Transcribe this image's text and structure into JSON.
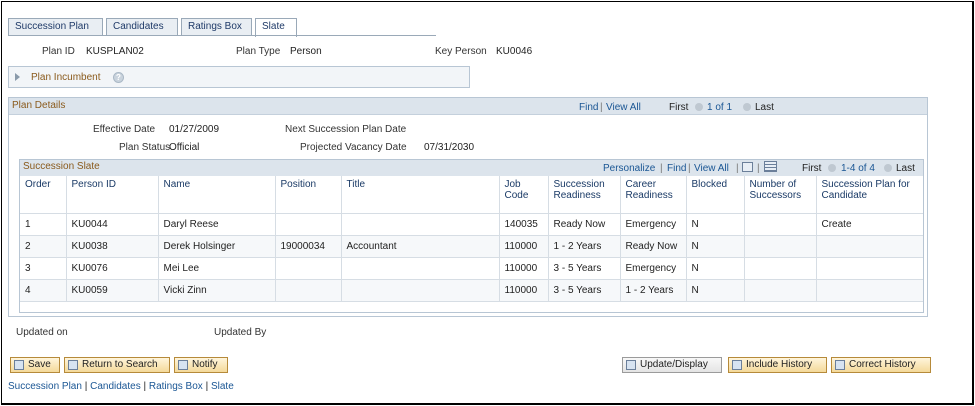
{
  "tabs": [
    {
      "label": "Succession Plan",
      "active": false
    },
    {
      "label": "Candidates",
      "active": false
    },
    {
      "label": "Ratings Box",
      "active": false
    },
    {
      "label": "Slate",
      "active": true
    }
  ],
  "header": {
    "plan_id_label": "Plan ID",
    "plan_id": "KUSPLAN02",
    "plan_type_label": "Plan Type",
    "plan_type": "Person",
    "key_person_label": "Key Person",
    "key_person": "KU0046"
  },
  "incumbent": {
    "label": "Plan Incumbent",
    "help_glyph": "?"
  },
  "details": {
    "title": "Plan Details",
    "find_label": "Find",
    "view_all_label": "View All",
    "first_label": "First",
    "count": "1 of 1",
    "last_label": "Last",
    "effective_date_label": "Effective Date",
    "effective_date": "01/27/2009",
    "next_plan_date_label": "Next Succession Plan Date",
    "plan_status_label": "Plan Status",
    "plan_status": "Official",
    "projected_vacancy_label": "Projected Vacancy Date",
    "projected_vacancy": "07/31/2030"
  },
  "slate": {
    "title": "Succession Slate",
    "personalize_label": "Personalize",
    "find_label": "Find",
    "view_all_label": "View All",
    "first_label": "First",
    "count": "1-4 of 4",
    "last_label": "Last",
    "columns": [
      "Order",
      "Person ID",
      "Name",
      "Position",
      "Title",
      "Job Code",
      "Succession Readiness",
      "Career Readiness",
      "Blocked",
      "Number of Successors",
      "Succession Plan for Candidate"
    ],
    "rows": [
      {
        "order": "1",
        "person_id": "KU0044",
        "name": "Daryl Reese",
        "position": "",
        "title": "",
        "job_code": "140035",
        "succession_readiness": "Ready Now",
        "career_readiness": "Emergency",
        "blocked": "N",
        "successors": "",
        "plan_for_candidate": "Create"
      },
      {
        "order": "2",
        "person_id": "KU0038",
        "name": "Derek Holsinger",
        "position": "19000034",
        "title": "Accountant",
        "job_code": "110000",
        "succession_readiness": "1 - 2 Years",
        "career_readiness": "Ready Now",
        "blocked": "N",
        "successors": "",
        "plan_for_candidate": ""
      },
      {
        "order": "3",
        "person_id": "KU0076",
        "name": "Mei Lee",
        "position": "",
        "title": "",
        "job_code": "110000",
        "succession_readiness": "3 - 5 Years",
        "career_readiness": "Emergency",
        "blocked": "N",
        "successors": "",
        "plan_for_candidate": ""
      },
      {
        "order": "4",
        "person_id": "KU0059",
        "name": "Vicki Zinn",
        "position": "",
        "title": "",
        "job_code": "110000",
        "succession_readiness": "3 - 5 Years",
        "career_readiness": "1 - 2 Years",
        "blocked": "N",
        "successors": "",
        "plan_for_candidate": ""
      }
    ]
  },
  "footer_info": {
    "updated_on_label": "Updated on",
    "updated_by_label": "Updated By"
  },
  "buttons": {
    "save": "Save",
    "return_to_search": "Return to Search",
    "notify": "Notify",
    "update_display": "Update/Display",
    "include_history": "Include History",
    "correct_history": "Correct History"
  },
  "bottom_links": {
    "items": [
      "Succession Plan",
      "Candidates",
      "Ratings Box",
      "Slate"
    ],
    "separator": "|"
  }
}
